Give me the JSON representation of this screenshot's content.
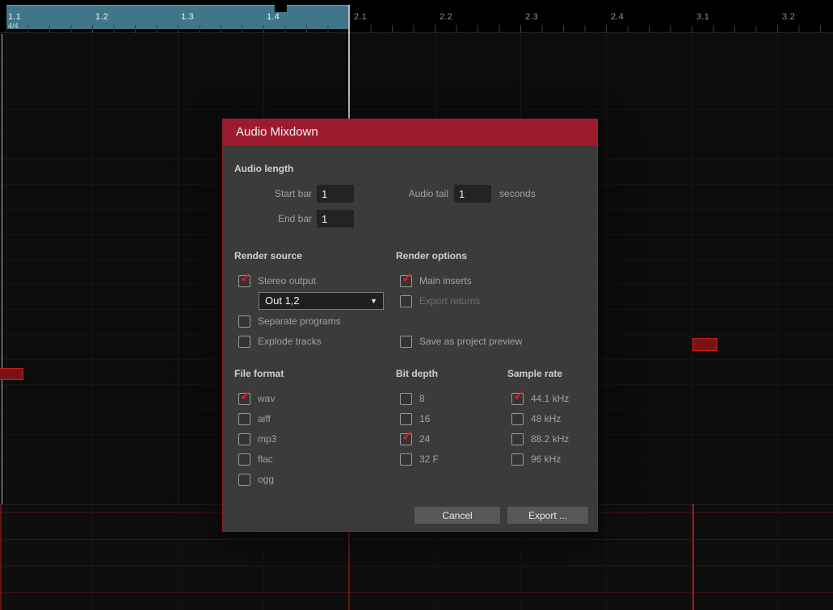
{
  "timeline": {
    "time_signature": "4/4",
    "ticks": [
      "1.1",
      "1.2",
      "1.3",
      "1.4",
      "2.1",
      "2.2",
      "2.3",
      "2.4",
      "3.1",
      "3.2"
    ]
  },
  "icons": {
    "check": "✓",
    "dropdown_arrow": "▼"
  },
  "dialog": {
    "title": "Audio Mixdown",
    "audio_length": {
      "heading": "Audio length",
      "start_bar": {
        "label": "Start bar",
        "value": "1"
      },
      "end_bar": {
        "label": "End bar",
        "value": "1"
      },
      "audio_tail": {
        "label": "Audio tail",
        "value": "1",
        "unit": "seconds"
      }
    },
    "render_source": {
      "heading": "Render source",
      "stereo_output": {
        "label": "Stereo output",
        "checked": true
      },
      "output_dropdown": {
        "value": "Out 1,2"
      },
      "separate_programs": {
        "label": "Separate programs",
        "checked": false
      },
      "explode_tracks": {
        "label": "Explode tracks",
        "checked": false
      }
    },
    "render_options": {
      "heading": "Render options",
      "main_inserts": {
        "label": "Main inserts",
        "checked": true
      },
      "export_returns": {
        "label": "Export returns",
        "checked": false
      },
      "save_as_project_preview": {
        "label": "Save as project preview",
        "checked": false
      }
    },
    "file_format": {
      "heading": "File format",
      "options": [
        {
          "label": "wav",
          "checked": true
        },
        {
          "label": "aiff",
          "checked": false
        },
        {
          "label": "mp3",
          "checked": false
        },
        {
          "label": "flac",
          "checked": false
        },
        {
          "label": "ogg",
          "checked": false
        }
      ]
    },
    "bit_depth": {
      "heading": "Bit depth",
      "options": [
        {
          "label": "8",
          "checked": false
        },
        {
          "label": "16",
          "checked": false
        },
        {
          "label": "24",
          "checked": true
        },
        {
          "label": "32 F",
          "checked": false
        }
      ]
    },
    "sample_rate": {
      "heading": "Sample rate",
      "options": [
        {
          "label": "44.1 kHz",
          "checked": true
        },
        {
          "label": "48 kHz",
          "checked": false
        },
        {
          "label": "88.2 kHz",
          "checked": false
        },
        {
          "label": "96 kHz",
          "checked": false
        }
      ]
    },
    "buttons": {
      "cancel": "Cancel",
      "export": "Export ..."
    }
  },
  "colors": {
    "dialog_titlebar": "#9e1b2f",
    "dialog_body": "#3b3b3b",
    "check_red": "#d5202a",
    "loop_region_teal": "#40768a",
    "clip_red": "#7a1414"
  }
}
